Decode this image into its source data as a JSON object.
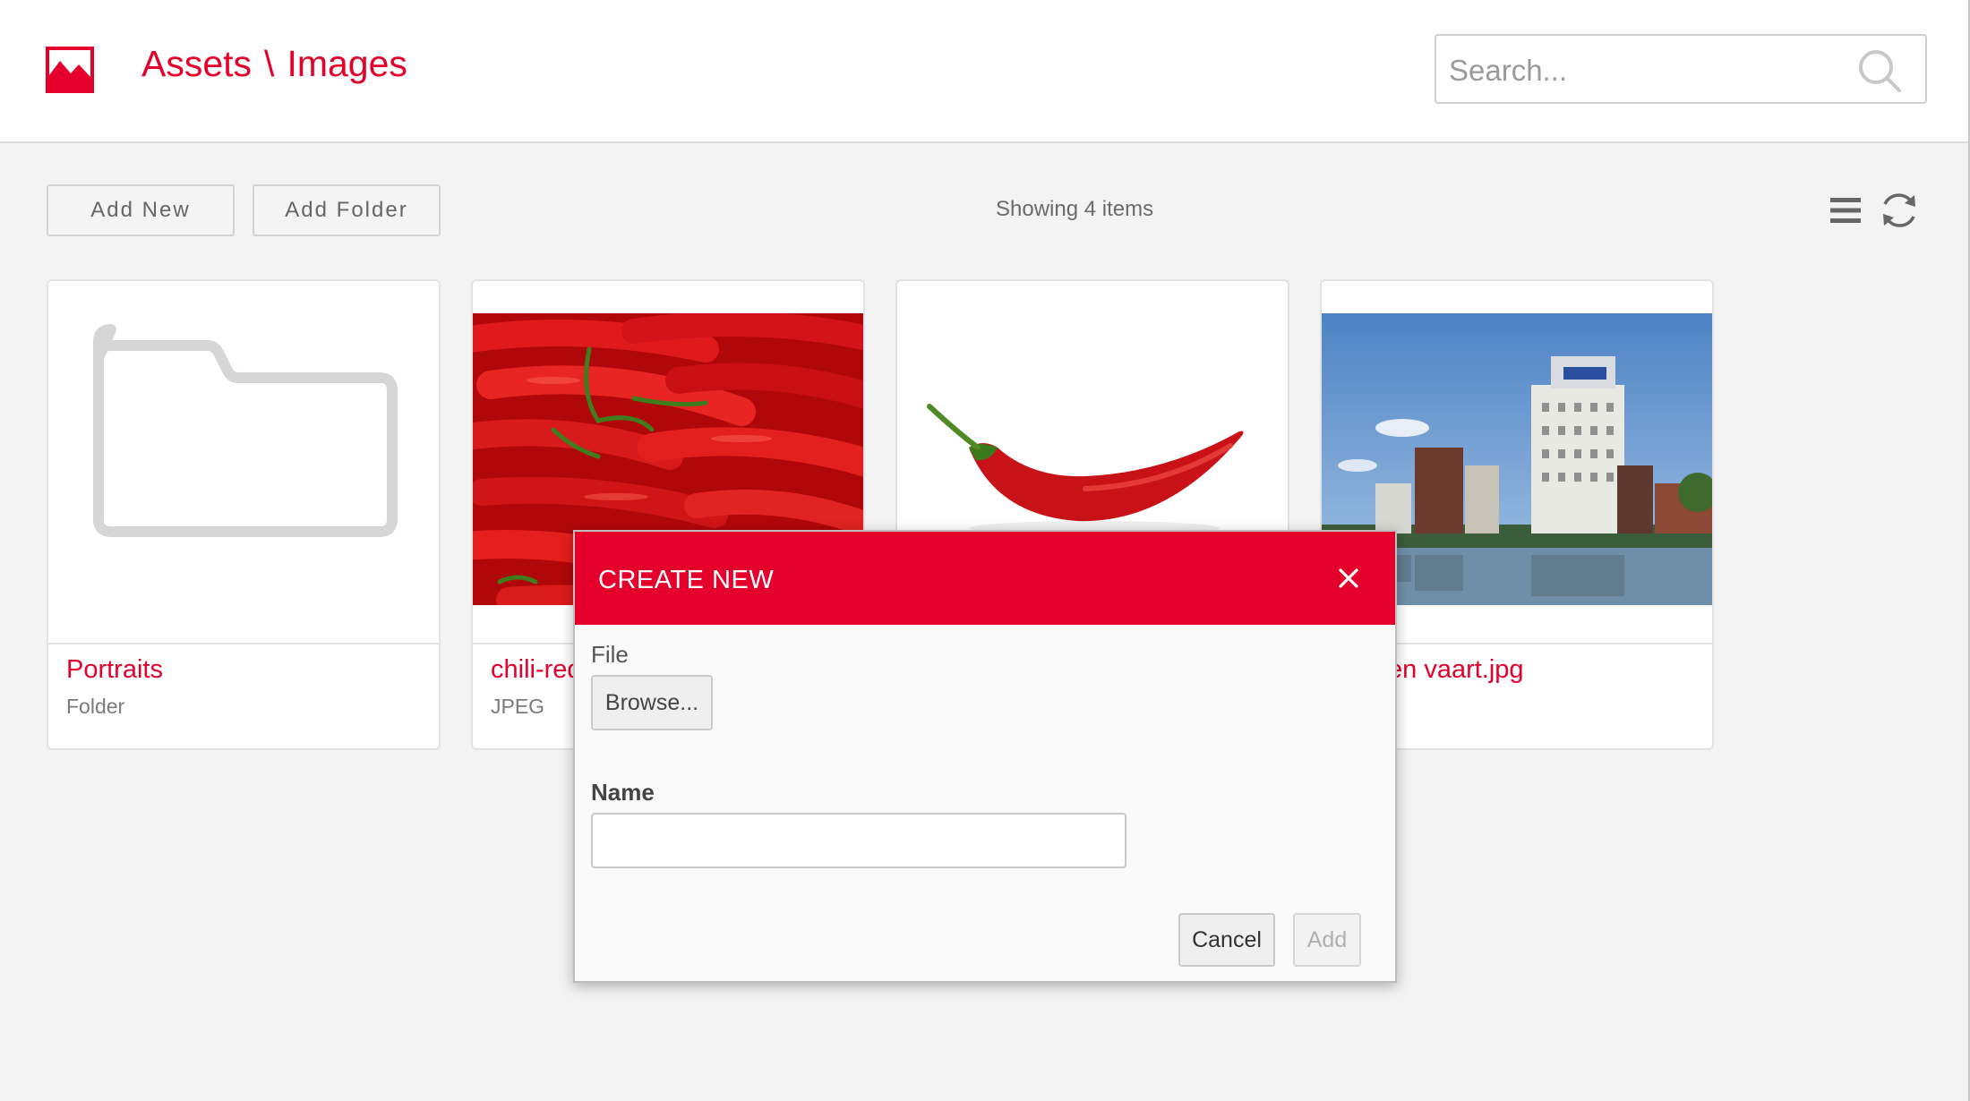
{
  "header": {
    "breadcrumb": {
      "root": "Assets",
      "separator": "\\",
      "current": "Images"
    },
    "logo_icon": "image-icon",
    "search": {
      "placeholder": "Search...",
      "value": "",
      "icon": "search-icon"
    }
  },
  "toolbar": {
    "add_new_label": "Add New",
    "add_folder_label": "Add Folder",
    "status_text": "Showing 4 items",
    "list_view_icon": "list-view-icon",
    "refresh_icon": "refresh-icon"
  },
  "assets": [
    {
      "title": "Portraits",
      "type": "Folder",
      "kind": "folder-icon"
    },
    {
      "title": "chili-red",
      "type": "JPEG",
      "kind": "image-thumbnail"
    },
    {
      "title": "",
      "type": "",
      "kind": "image-thumbnail"
    },
    {
      "title": "en vaart.jpg",
      "type": "",
      "kind": "image-thumbnail"
    }
  ],
  "dialog": {
    "title": "CREATE NEW",
    "close_icon": "close-icon",
    "file_label": "File",
    "browse_label": "Browse...",
    "name_label": "Name",
    "name_value": "",
    "cancel_label": "Cancel",
    "add_label": "Add"
  },
  "colors": {
    "accent": "#e4002b",
    "background": "#f3f3f3",
    "card": "#ffffff",
    "border": "#dcdcdc"
  }
}
